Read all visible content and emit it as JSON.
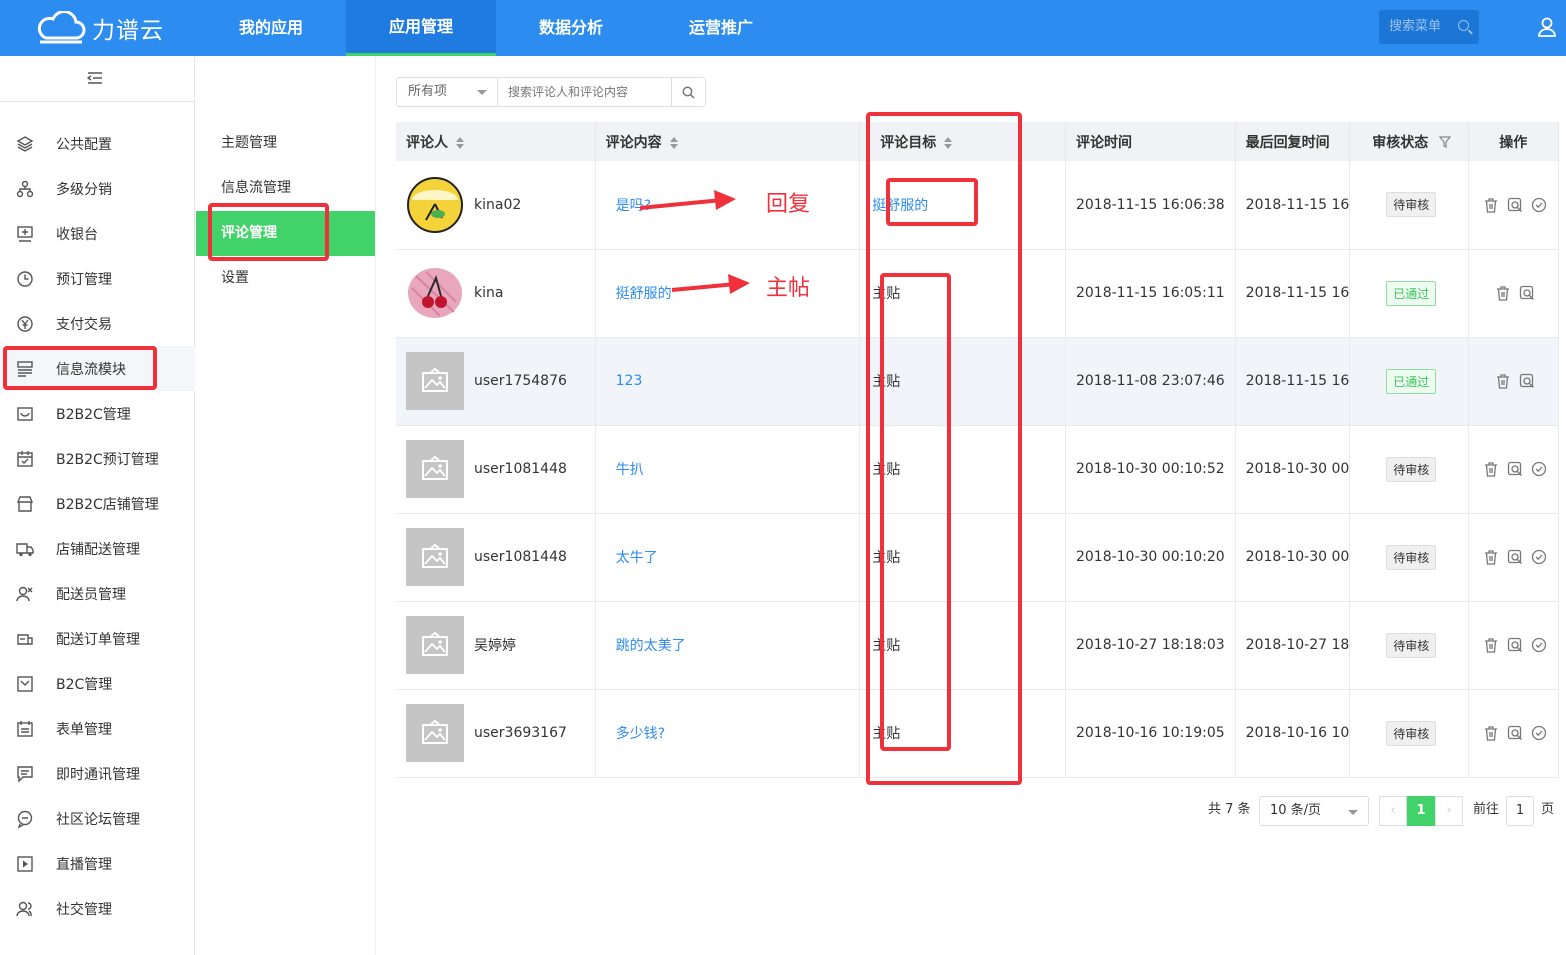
{
  "colors": {
    "primary": "#2d8cf0",
    "accent_green": "#42d26a",
    "annotation_red": "#f0313c"
  },
  "header": {
    "logo_icon": "cloud-icon",
    "logo_text": "力谱云",
    "nav": [
      "我的应用",
      "应用管理",
      "数据分析",
      "运营推广"
    ],
    "active_nav": "应用管理",
    "search_menu_label": "搜索菜单",
    "user_icon": "user-icon"
  },
  "sidebar": {
    "items": [
      {
        "label": "公共配置",
        "icon": "layers-icon"
      },
      {
        "label": "多级分销",
        "icon": "network-icon"
      },
      {
        "label": "收银台",
        "icon": "cashier-icon"
      },
      {
        "label": "预订管理",
        "icon": "clock-icon"
      },
      {
        "label": "支付交易",
        "icon": "yen-icon"
      },
      {
        "label": "信息流模块",
        "icon": "feed-icon"
      },
      {
        "label": "B2B2C管理",
        "icon": "store-icon"
      },
      {
        "label": "B2B2C预订管理",
        "icon": "calendar-check-icon"
      },
      {
        "label": "B2B2C店铺管理",
        "icon": "shop-icon"
      },
      {
        "label": "店铺配送管理",
        "icon": "truck-icon"
      },
      {
        "label": "配送员管理",
        "icon": "courier-icon"
      },
      {
        "label": "配送订单管理",
        "icon": "order-icon"
      },
      {
        "label": "B2C管理",
        "icon": "cart-icon"
      },
      {
        "label": "表单管理",
        "icon": "form-icon"
      },
      {
        "label": "即时通讯管理",
        "icon": "chat-icon"
      },
      {
        "label": "社区论坛管理",
        "icon": "forum-icon"
      },
      {
        "label": "直播管理",
        "icon": "play-icon"
      },
      {
        "label": "社交管理",
        "icon": "social-icon"
      }
    ],
    "active": "信息流模块"
  },
  "subnav": {
    "items": [
      "主题管理",
      "信息流管理",
      "评论管理",
      "设置"
    ],
    "active": "评论管理"
  },
  "filter": {
    "select_value": "所有项",
    "search_placeholder": "搜索评论人和评论内容"
  },
  "table": {
    "columns": [
      "评论人",
      "评论内容",
      "评论目标",
      "评论时间",
      "最后回复时间",
      "审核状态",
      "操作"
    ],
    "rows": [
      {
        "name": "kina02",
        "avatar": "lemon",
        "content": "是吗?",
        "target": "挺舒服的",
        "time": "2018-11-15 16:06:38",
        "reply_time": "2018-11-15 16",
        "status": "待审核"
      },
      {
        "name": "kina",
        "avatar": "cherry",
        "content": "挺舒服的",
        "target": "主贴",
        "time": "2018-11-15 16:05:11",
        "reply_time": "2018-11-15 16",
        "status": "已通过"
      },
      {
        "name": "user1754876",
        "avatar": "placeholder",
        "content": "123",
        "target": "主贴",
        "time": "2018-11-08 23:07:46",
        "reply_time": "2018-11-15 16",
        "status": "已通过"
      },
      {
        "name": "user1081448",
        "avatar": "placeholder",
        "content": "牛扒",
        "target": "主贴",
        "time": "2018-10-30 00:10:52",
        "reply_time": "2018-10-30 00",
        "status": "待审核"
      },
      {
        "name": "user1081448",
        "avatar": "placeholder",
        "content": "太牛了",
        "target": "主贴",
        "time": "2018-10-30 00:10:20",
        "reply_time": "2018-10-30 00",
        "status": "待审核"
      },
      {
        "name": "吴婷婷",
        "avatar": "placeholder",
        "content": "跳的太美了",
        "target": "主贴",
        "time": "2018-10-27 18:18:03",
        "reply_time": "2018-10-27 18",
        "status": "待审核"
      },
      {
        "name": "user3693167",
        "avatar": "placeholder",
        "content": "多少钱?",
        "target": "主贴",
        "time": "2018-10-16 10:19:05",
        "reply_time": "2018-10-16 10",
        "status": "待审核"
      }
    ]
  },
  "pagination": {
    "total": "共 7 条",
    "page_size": "10 条/页",
    "current_page": "1",
    "goto_label": "前往",
    "goto_value": "1",
    "page_suffix": "页"
  },
  "annotations": {
    "reply_label": "回复",
    "main_post_label": "主帖"
  }
}
